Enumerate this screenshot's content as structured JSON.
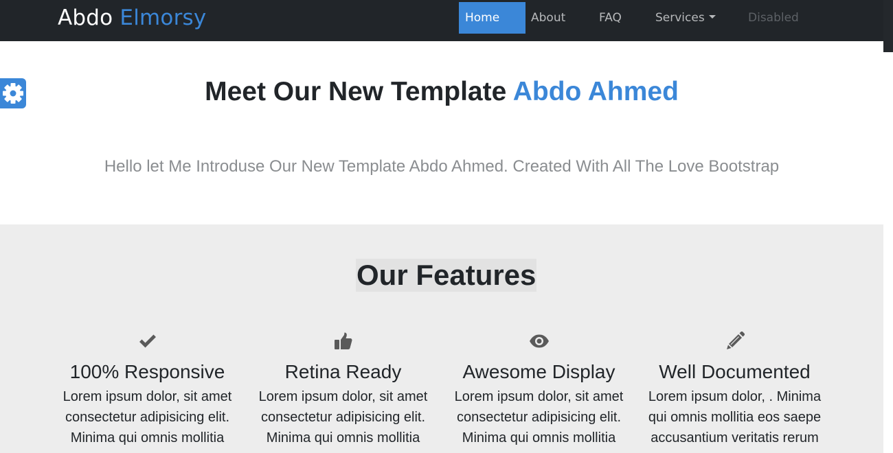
{
  "navbar": {
    "brand_main": "Abdo",
    "brand_accent": "Elmorsy",
    "links": {
      "home": "Home",
      "about": "About",
      "faq": "FAQ",
      "services": "Services",
      "disabled": "Disabled"
    }
  },
  "settings": {
    "icon": "gear-icon"
  },
  "hero": {
    "title_main": "Meet Our New Template",
    "title_accent": "Abdo Ahmed",
    "subtitle": "Hello let Me Introduse Our New Template Abdo Ahmed. Created With All The Love Bootstrap"
  },
  "features": {
    "title": "Our Features",
    "items": [
      {
        "icon": "check-icon",
        "title": "100% Responsive",
        "text_lines": [
          "Lorem ipsum dolor, sit amet",
          "consectetur adipisicing elit.",
          "Minima qui omnis mollitia"
        ]
      },
      {
        "icon": "thumbs-up-icon",
        "title": "Retina Ready",
        "text_lines": [
          "Lorem ipsum dolor, sit amet",
          "consectetur adipisicing elit.",
          "Minima qui omnis mollitia"
        ]
      },
      {
        "icon": "eye-icon",
        "title": "Awesome Display",
        "text_lines": [
          "Lorem ipsum dolor, sit amet",
          "consectetur adipisicing elit.",
          "Minima qui omnis mollitia"
        ]
      },
      {
        "icon": "pencil-icon",
        "title": "Well Documented",
        "text_lines": [
          "Lorem ipsum dolor, . Minima",
          "qui omnis mollitia eos saepe",
          "accusantium veritatis rerum"
        ]
      }
    ]
  },
  "colors": {
    "accent": "#3b87d8",
    "navbar_bg": "#212529",
    "features_bg": "#ededed",
    "icon": "#5a5a5a"
  }
}
